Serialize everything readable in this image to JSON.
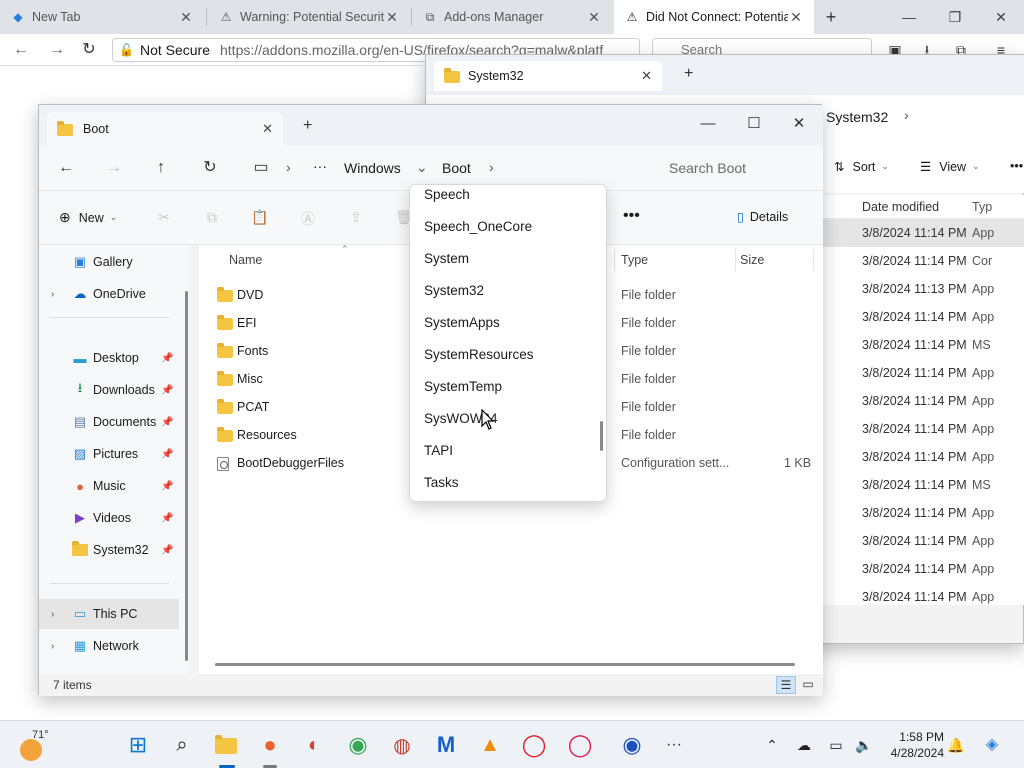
{
  "browser": {
    "tabs": [
      {
        "label": "New Tab",
        "icon": "firefox-new-tab-icon"
      },
      {
        "label": "Warning: Potential Security",
        "icon": "warning-icon"
      },
      {
        "label": "Add-ons Manager",
        "icon": "puzzle-icon"
      },
      {
        "label": "Did Not Connect: Potential",
        "icon": "warning-icon"
      }
    ],
    "address": {
      "security": "Not Secure",
      "url": "https://addons.mozilla.org/en-US/firefox/search?q=malw&platf"
    },
    "search_placeholder": "Search"
  },
  "system32_window": {
    "tab_label": "System32",
    "breadcrumb": "System32",
    "sort_label": "Sort",
    "view_label": "View",
    "columns": {
      "date": "Date modified",
      "type": "Typ"
    },
    "rows": [
      {
        "date": "3/8/2024 11:14 PM",
        "type": "App",
        "selected": true
      },
      {
        "date": "3/8/2024 11:14 PM",
        "type": "Cor"
      },
      {
        "date": "3/8/2024 11:13 PM",
        "type": "App"
      },
      {
        "date": "3/8/2024 11:14 PM",
        "type": "App"
      },
      {
        "date": "3/8/2024 11:14 PM",
        "type": "MS"
      },
      {
        "date": "3/8/2024 11:14 PM",
        "type": "App"
      },
      {
        "date": "3/8/2024 11:14 PM",
        "type": "App"
      },
      {
        "date": "3/8/2024 11:14 PM",
        "type": "App"
      },
      {
        "date": "3/8/2024 11:14 PM",
        "type": "App"
      },
      {
        "date": "3/8/2024 11:14 PM",
        "type": "MS"
      },
      {
        "date": "3/8/2024 11:14 PM",
        "type": "App"
      },
      {
        "date": "3/8/2024 11:14 PM",
        "type": "App"
      },
      {
        "date": "3/8/2024 11:14 PM",
        "type": "App"
      },
      {
        "date": "3/8/2024 11:14 PM",
        "type": "App"
      }
    ]
  },
  "boot_window": {
    "tab_label": "Boot",
    "breadcrumbs": [
      "Windows",
      "Boot"
    ],
    "search_placeholder": "Search Boot",
    "cmd": {
      "new_label": "New",
      "details_label": "Details"
    },
    "nav": {
      "gallery": "Gallery",
      "onedrive": "OneDrive",
      "desktop": "Desktop",
      "downloads": "Downloads",
      "documents": "Documents",
      "pictures": "Pictures",
      "music": "Music",
      "videos": "Videos",
      "system32": "System32",
      "this_pc": "This PC",
      "network": "Network"
    },
    "columns": {
      "name": "Name",
      "type": "Type",
      "size": "Size"
    },
    "files": [
      {
        "name": "DVD",
        "type": "File folder",
        "size": "",
        "kind": "folder"
      },
      {
        "name": "EFI",
        "type": "File folder",
        "size": "",
        "kind": "folder"
      },
      {
        "name": "Fonts",
        "type": "File folder",
        "size": "",
        "kind": "folder"
      },
      {
        "name": "Misc",
        "type": "File folder",
        "size": "",
        "kind": "folder"
      },
      {
        "name": "PCAT",
        "type": "File folder",
        "size": "",
        "kind": "folder"
      },
      {
        "name": "Resources",
        "type": "File folder",
        "size": "",
        "kind": "folder"
      },
      {
        "name": "BootDebuggerFiles",
        "type": "Configuration sett...",
        "size": "1 KB",
        "kind": "config"
      }
    ],
    "status_count": "7 items"
  },
  "dropdown": {
    "items": [
      "Speech",
      "Speech_OneCore",
      "System",
      "System32",
      "SystemApps",
      "SystemResources",
      "SystemTemp",
      "SysWOW64",
      "TAPI",
      "Tasks"
    ]
  },
  "taskbar": {
    "weather_temp": "71°",
    "time": "1:58 PM",
    "date": "4/28/2024"
  },
  "colors": {
    "accent": "#0067c0",
    "folder": "#f4c542",
    "selection": "#e5e5e5"
  }
}
